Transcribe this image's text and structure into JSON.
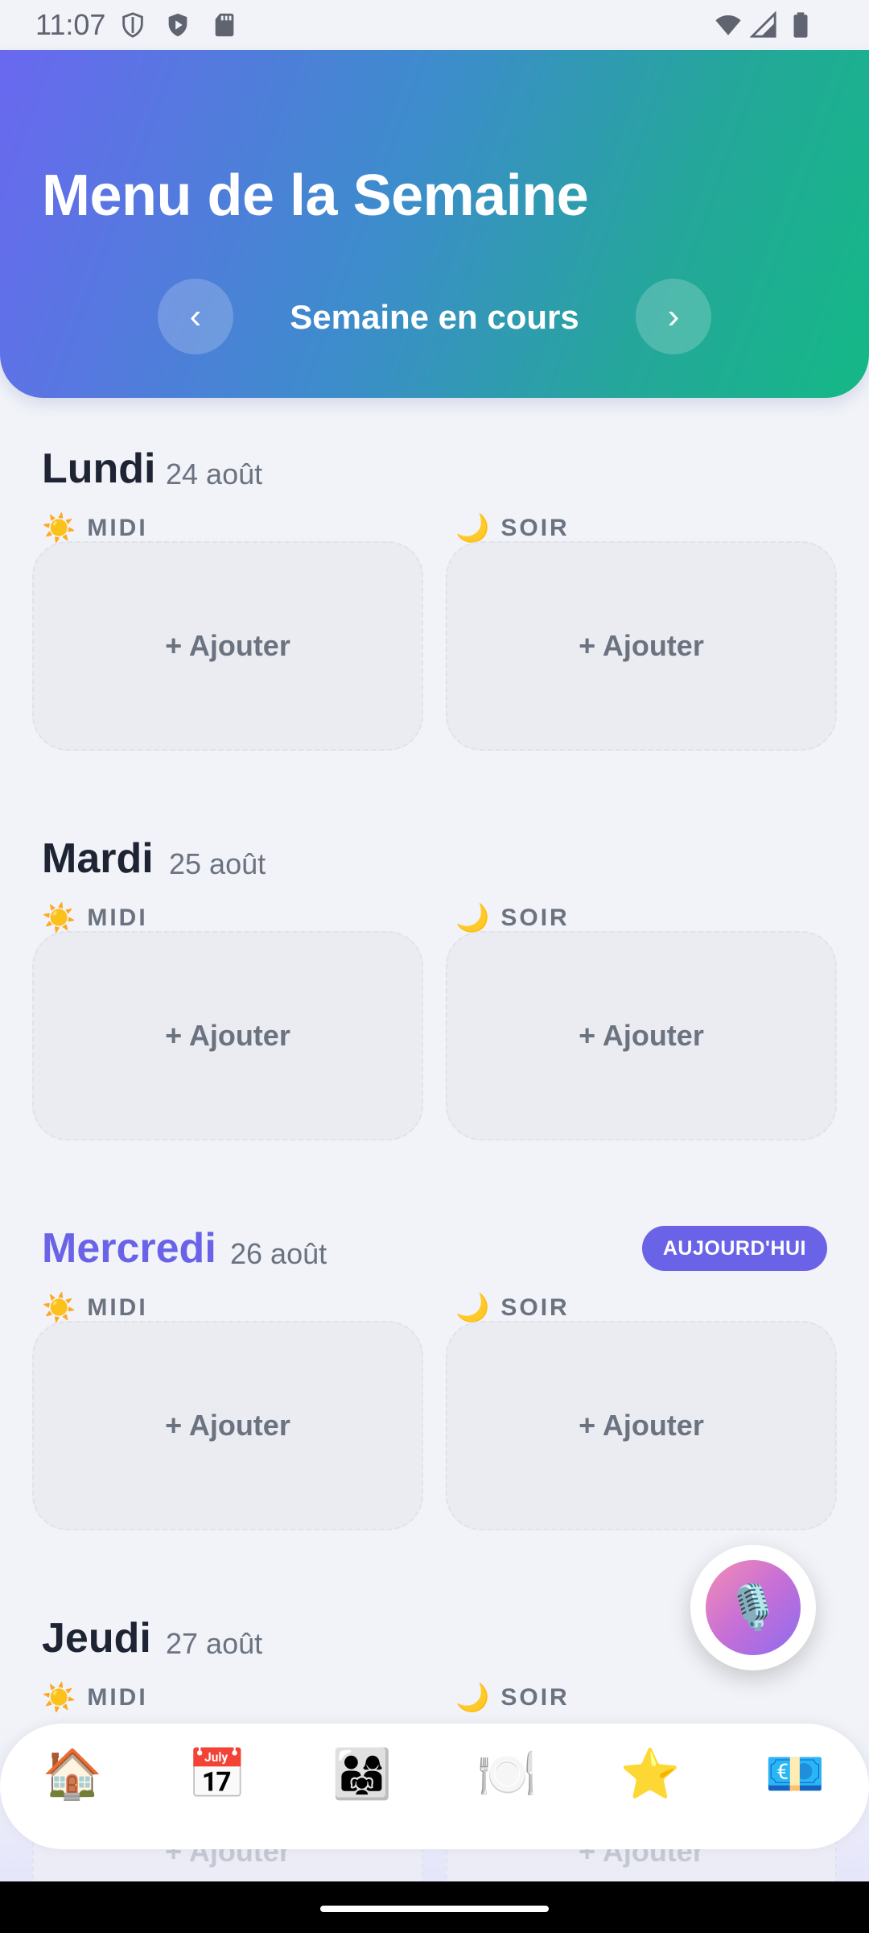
{
  "status_bar": {
    "time": "11:07",
    "icons": [
      "shield-icon",
      "play-protect-icon",
      "sd-card-icon",
      "wifi-icon",
      "signal-icon",
      "battery-icon"
    ]
  },
  "header": {
    "title": "Menu de la Semaine",
    "week_label": "Semaine en cours",
    "prev_glyph": "‹",
    "next_glyph": "›",
    "gradient_colors": [
      "#6a68f0",
      "#14b886"
    ]
  },
  "meal_labels": {
    "lunch": "MIDI",
    "dinner": "SOIR",
    "lunch_icon": "☀️",
    "dinner_icon": "🌙"
  },
  "add_label": "+ Ajouter",
  "today_badge": "AUJOURD'HUI",
  "days": [
    {
      "name": "Lundi",
      "date": "24 août",
      "today": false
    },
    {
      "name": "Mardi",
      "date": "25 août",
      "today": false
    },
    {
      "name": "Mercredi",
      "date": "26 août",
      "today": true
    },
    {
      "name": "Jeudi",
      "date": "27 août",
      "today": false
    }
  ],
  "fab": {
    "icon": "🎙️"
  },
  "bottom_nav": [
    {
      "name": "home",
      "icon": "🏠"
    },
    {
      "name": "calendar",
      "icon": "📅"
    },
    {
      "name": "family",
      "icon": "👨‍👩‍👧"
    },
    {
      "name": "meals",
      "icon": "🍽️"
    },
    {
      "name": "favorites",
      "icon": "⭐"
    },
    {
      "name": "budget",
      "icon": "💶"
    }
  ],
  "colors": {
    "accent": "#6a63e8",
    "background": "#f1f3f8",
    "text_dark": "#1e2433",
    "text_muted": "#6b7280"
  }
}
